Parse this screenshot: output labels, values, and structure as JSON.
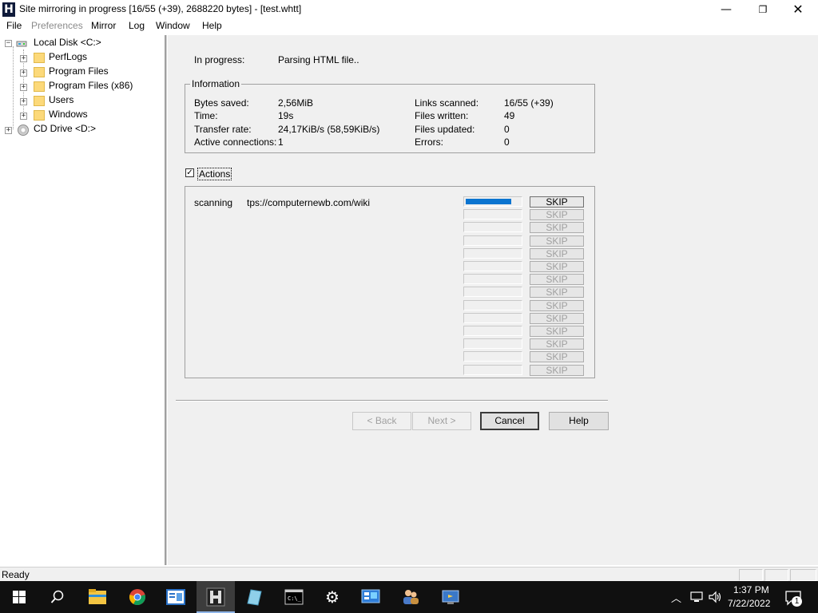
{
  "window": {
    "icon_letter": "H",
    "title": "Site mirroring in progress [16/55 (+39), 2688220 bytes] - [test.whtt]",
    "minimize": "—",
    "maximize": "❐",
    "close": "✕"
  },
  "menu": {
    "items": [
      "File",
      "Preferences",
      "Mirror",
      "Log",
      "Window",
      "Help"
    ],
    "disabled": [
      "Preferences"
    ]
  },
  "tree": {
    "root": "Local Disk <C:>",
    "folders": [
      "PerfLogs",
      "Program Files",
      "Program Files (x86)",
      "Users",
      "Windows"
    ],
    "cd_drive": "CD Drive <D:>"
  },
  "status_row": {
    "label": "In progress:",
    "value": "Parsing HTML file.."
  },
  "information": {
    "legend": "Information",
    "left": [
      {
        "label": "Bytes saved:",
        "value": "2,56MiB"
      },
      {
        "label": "Time:",
        "value": "19s"
      },
      {
        "label": "Transfer rate:",
        "value": "24,17KiB/s (58,59KiB/s)"
      },
      {
        "label": "Active connections:",
        "value": "1"
      }
    ],
    "right": [
      {
        "label": "Links scanned:",
        "value": "16/55 (+39)"
      },
      {
        "label": "Files written:",
        "value": "49"
      },
      {
        "label": "Files updated:",
        "value": "0"
      },
      {
        "label": "Errors:",
        "value": "0"
      }
    ]
  },
  "actions": {
    "checkbox_checked": true,
    "check_mark": "✓",
    "label": "Actions",
    "current_action": "scanning",
    "current_url": "tps://computernewb.com/wiki",
    "skip_label": "SKIP",
    "progress_fraction": 0.82,
    "slot_count": 14
  },
  "buttons": {
    "back": "< Back",
    "next": "Next >",
    "cancel": "Cancel",
    "help": "Help"
  },
  "statusbar": {
    "text": "Ready"
  },
  "taskbar": {
    "time": "1:37 PM",
    "date": "7/22/2022",
    "notification_count": "1",
    "accent_color": "#0a74d0"
  }
}
